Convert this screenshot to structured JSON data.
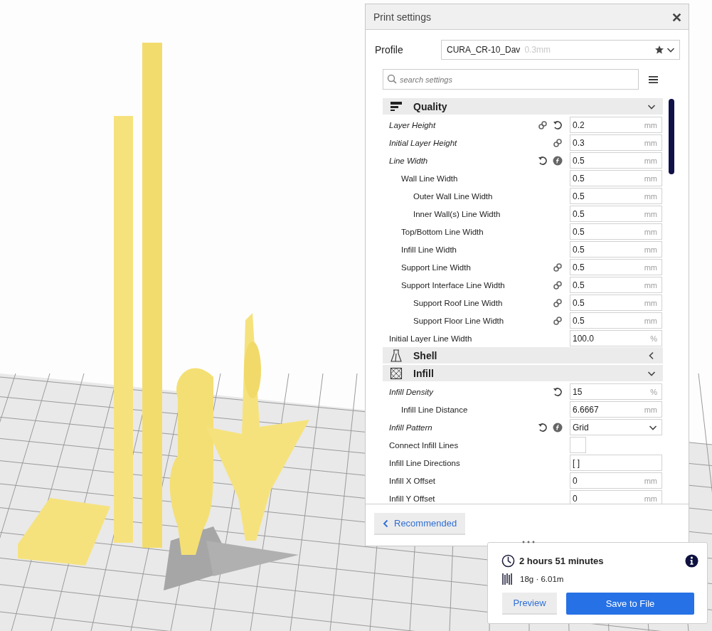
{
  "print_settings": {
    "title": "Print settings",
    "profile": {
      "label": "Profile",
      "name": "CURA_CR-10_Dav",
      "suffix": "0.3mm"
    },
    "search": {
      "placeholder": "search settings"
    },
    "categories": [
      {
        "title": "Quality",
        "expanded": true,
        "settings": [
          {
            "label": "Layer Height",
            "modified": true,
            "linked": true,
            "resettable": true,
            "inherits": false,
            "kind": "number",
            "value": "0.2",
            "unit": "mm"
          },
          {
            "label": "Initial Layer Height",
            "modified": true,
            "linked": true,
            "resettable": false,
            "inherits": false,
            "kind": "number",
            "value": "0.3",
            "unit": "mm"
          },
          {
            "label": "Line Width",
            "modified": true,
            "linked": false,
            "resettable": true,
            "inherits": true,
            "kind": "number",
            "value": "0.5",
            "unit": "mm",
            "children": [
              {
                "label": "Wall Line Width",
                "modified": false,
                "linked": false,
                "resettable": false,
                "inherits": false,
                "kind": "number",
                "value": "0.5",
                "unit": "mm",
                "children": [
                  {
                    "label": "Outer Wall Line Width",
                    "modified": false,
                    "linked": false,
                    "resettable": false,
                    "inherits": false,
                    "kind": "number",
                    "value": "0.5",
                    "unit": "mm"
                  },
                  {
                    "label": "Inner Wall(s) Line Width",
                    "modified": false,
                    "linked": false,
                    "resettable": false,
                    "inherits": false,
                    "kind": "number",
                    "value": "0.5",
                    "unit": "mm"
                  }
                ]
              },
              {
                "label": "Top/Bottom Line Width",
                "modified": false,
                "linked": false,
                "resettable": false,
                "inherits": false,
                "kind": "number",
                "value": "0.5",
                "unit": "mm"
              },
              {
                "label": "Infill Line Width",
                "modified": false,
                "linked": false,
                "resettable": false,
                "inherits": false,
                "kind": "number",
                "value": "0.5",
                "unit": "mm"
              },
              {
                "label": "Support Line Width",
                "modified": false,
                "linked": true,
                "resettable": false,
                "inherits": false,
                "kind": "number",
                "value": "0.5",
                "unit": "mm"
              },
              {
                "label": "Support Interface Line Width",
                "modified": false,
                "linked": true,
                "resettable": false,
                "inherits": false,
                "kind": "number",
                "value": "0.5",
                "unit": "mm",
                "children": [
                  {
                    "label": "Support Roof Line Width",
                    "modified": false,
                    "linked": true,
                    "resettable": false,
                    "inherits": false,
                    "kind": "number",
                    "value": "0.5",
                    "unit": "mm"
                  },
                  {
                    "label": "Support Floor Line Width",
                    "modified": false,
                    "linked": true,
                    "resettable": false,
                    "inherits": false,
                    "kind": "number",
                    "value": "0.5",
                    "unit": "mm"
                  }
                ]
              }
            ]
          },
          {
            "label": "Initial Layer Line Width",
            "modified": false,
            "linked": false,
            "resettable": false,
            "inherits": false,
            "kind": "number",
            "value": "100.0",
            "unit": "%"
          }
        ]
      },
      {
        "title": "Shell",
        "expanded": false
      },
      {
        "title": "Infill",
        "expanded": true,
        "settings": [
          {
            "label": "Infill Density",
            "modified": true,
            "linked": false,
            "resettable": true,
            "inherits": false,
            "kind": "number",
            "value": "15",
            "unit": "%",
            "children": [
              {
                "label": "Infill Line Distance",
                "modified": false,
                "linked": false,
                "resettable": false,
                "inherits": false,
                "kind": "number",
                "value": "6.6667",
                "unit": "mm"
              }
            ]
          },
          {
            "label": "Infill Pattern",
            "modified": true,
            "linked": false,
            "resettable": true,
            "inherits": true,
            "kind": "dropdown",
            "value": "Grid"
          },
          {
            "label": "Connect Infill Lines",
            "modified": false,
            "linked": false,
            "resettable": false,
            "inherits": false,
            "kind": "checkbox",
            "checked": false
          },
          {
            "label": "Infill Line Directions",
            "modified": false,
            "linked": false,
            "resettable": false,
            "inherits": false,
            "kind": "text",
            "value": "[ ]"
          },
          {
            "label": "Infill X Offset",
            "modified": false,
            "linked": false,
            "resettable": false,
            "inherits": false,
            "kind": "number",
            "value": "0",
            "unit": "mm"
          },
          {
            "label": "Infill Y Offset",
            "modified": false,
            "linked": false,
            "resettable": false,
            "inherits": false,
            "kind": "number",
            "value": "0",
            "unit": "mm"
          }
        ]
      }
    ],
    "mode_button": "Recommended"
  },
  "summary": {
    "time": "2 hours 51 minutes",
    "material": "18g · 6.01m",
    "buttons": [
      "Preview",
      "Save to File"
    ]
  }
}
